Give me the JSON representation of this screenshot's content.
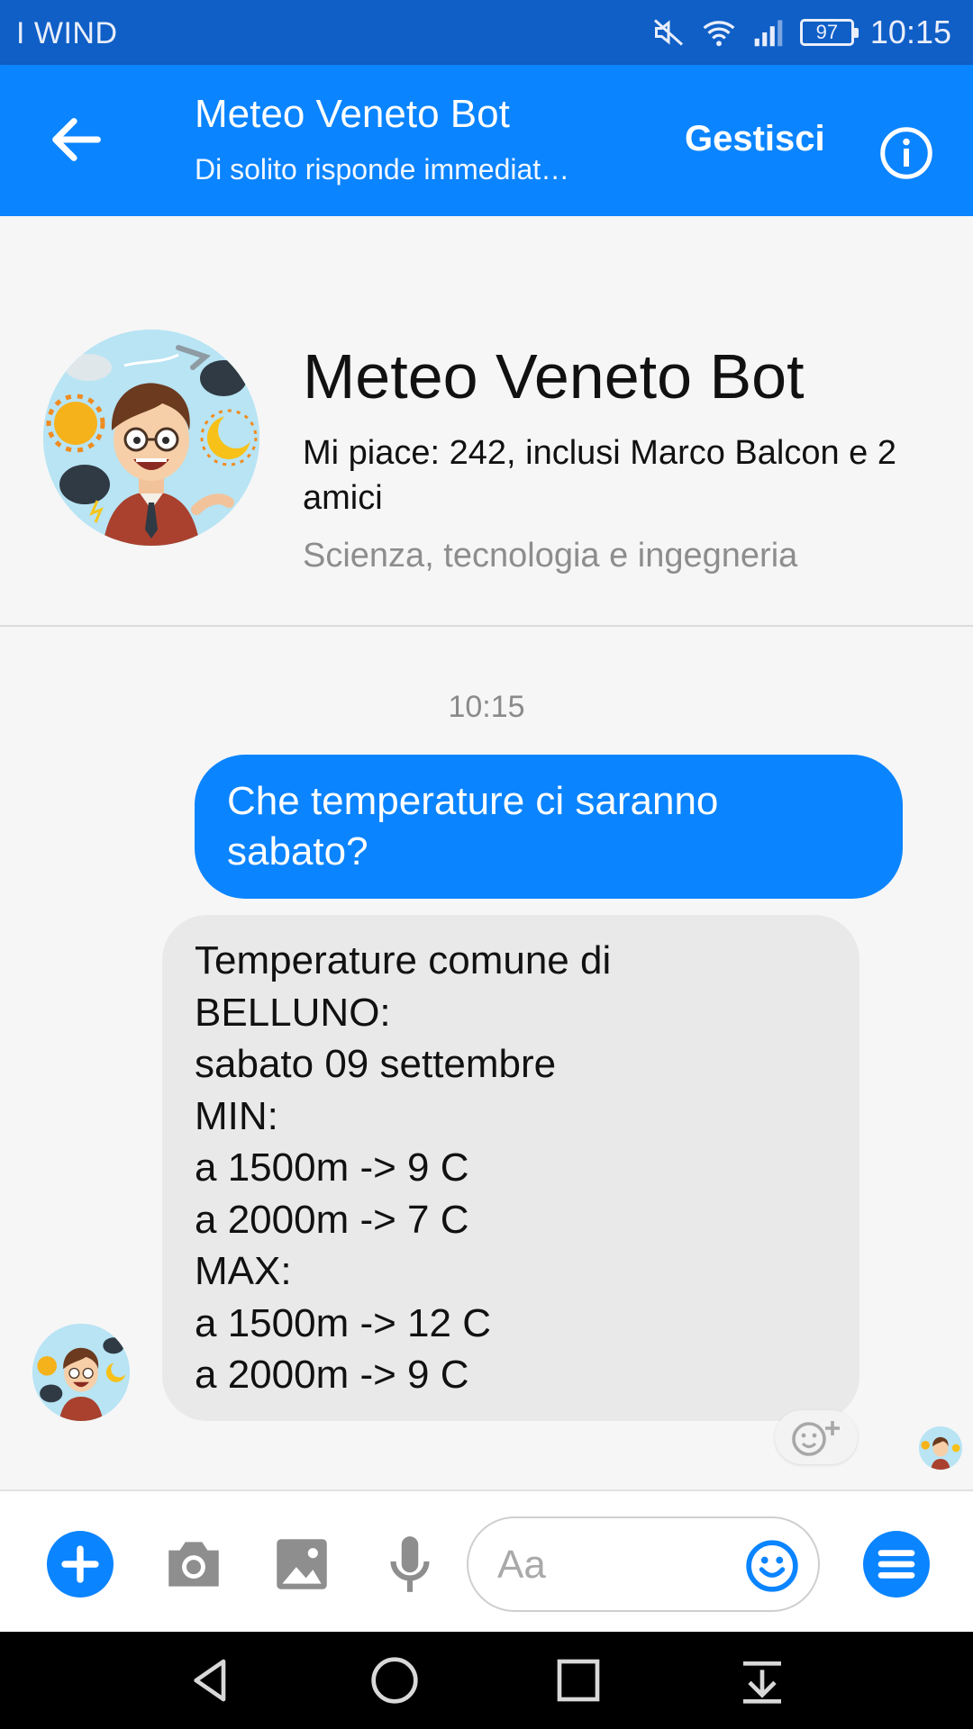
{
  "status_bar": {
    "carrier": "I WIND",
    "battery": "97",
    "time": "10:15"
  },
  "app_bar": {
    "title": "Meteo Veneto Bot",
    "subtitle": "Di solito risponde immediat…",
    "manage_label": "Gestisci"
  },
  "profile": {
    "name": "Meteo Veneto Bot",
    "likes": "Mi piace: 242, inclusi Marco Balcon e 2 amici",
    "category": "Scienza, tecnologia e ingegneria"
  },
  "conversation": {
    "timestamp": "10:15",
    "sent_message": "Che temperature ci saranno sabato?",
    "received_lines": [
      "Temperature comune di",
      "BELLUNO:",
      "sabato 09 settembre",
      "MIN:",
      "a 1500m -> 9 C",
      "a 2000m -> 7 C",
      "MAX:",
      "a 1500m -> 12 C",
      "a 2000m -> 9 C"
    ]
  },
  "composer": {
    "placeholder": "Aa"
  },
  "colors": {
    "messenger_blue": "#0b84ff",
    "status_bar": "#0f5fc7",
    "incoming_bubble": "#e9e9e9",
    "icon_gray": "#8e8e8e"
  },
  "icons": {
    "back": "arrow-left-icon",
    "info": "info-icon",
    "add": "plus-icon",
    "camera": "camera-icon",
    "gallery": "image-icon",
    "mic": "microphone-icon",
    "emoji": "smiley-icon",
    "menu": "menu-icon",
    "react": "add-reaction-icon"
  }
}
